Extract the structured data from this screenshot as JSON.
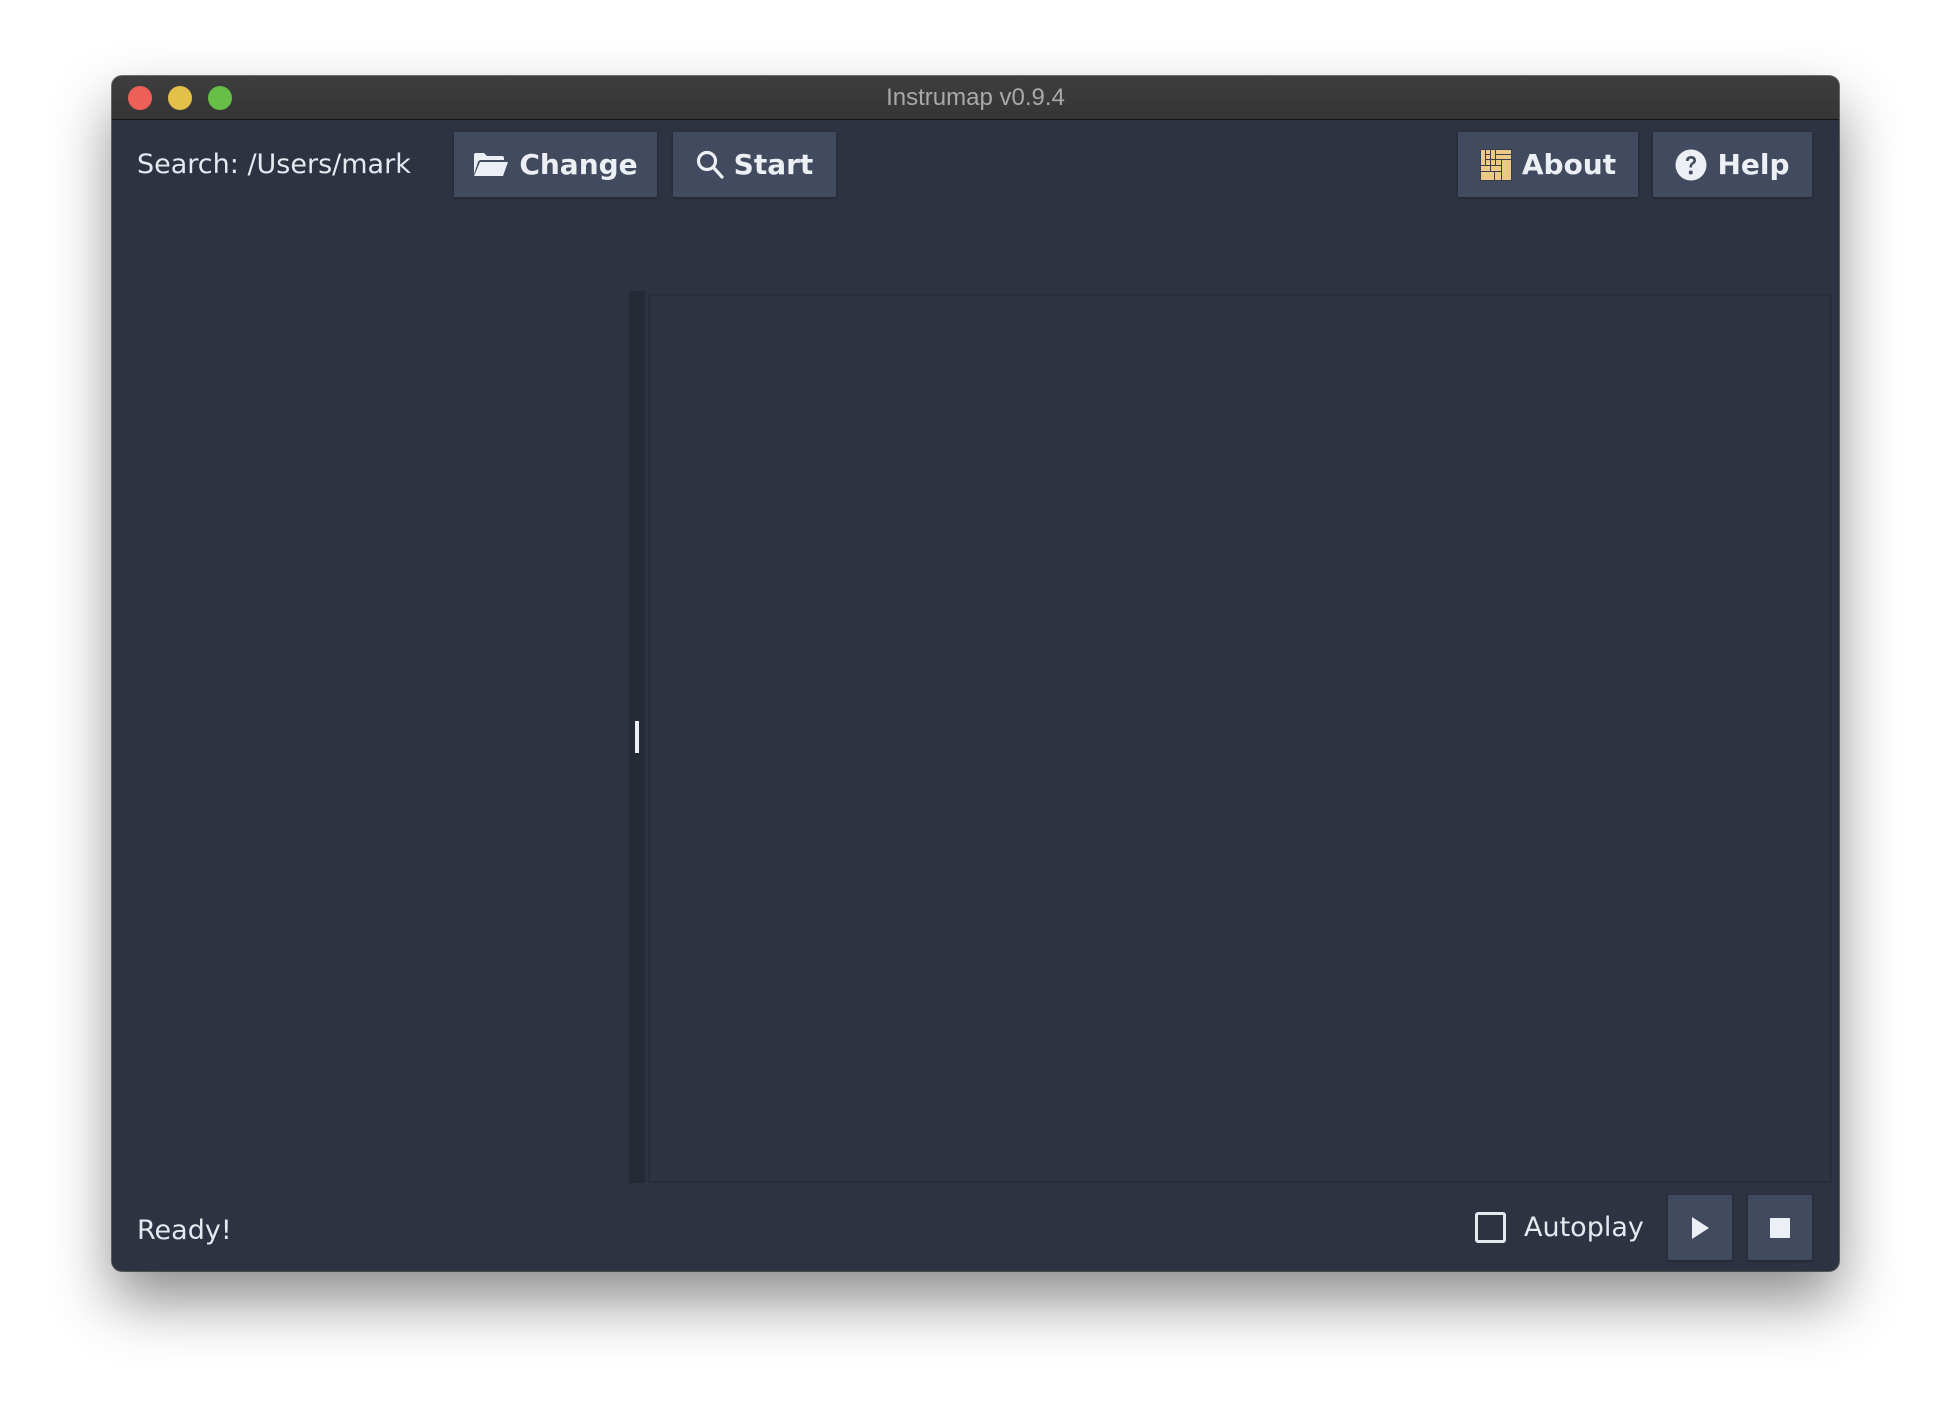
{
  "window": {
    "title": "Instrumap v0.9.4",
    "traffic_lights": {
      "close_color": "#ee5f57",
      "minimize_color": "#e2c04a",
      "maximize_color": "#67be46"
    }
  },
  "toolbar": {
    "search_label": "Search: /Users/mark",
    "change_button": {
      "label": "Change",
      "icon": "folder-open-icon"
    },
    "start_button": {
      "label": "Start",
      "icon": "search-icon"
    },
    "about_button": {
      "label": "About",
      "icon": "treemap-icon",
      "icon_color": "#ecc986"
    },
    "help_button": {
      "label": "Help",
      "icon": "question-circle-icon"
    }
  },
  "panels": {
    "left": {
      "items": []
    },
    "right": {
      "content": []
    }
  },
  "footer": {
    "status": "Ready!",
    "autoplay": {
      "label": "Autoplay",
      "checked": false
    },
    "play_button": {
      "icon": "play-icon"
    },
    "stop_button": {
      "icon": "stop-icon"
    }
  },
  "colors": {
    "background": "#2e3342",
    "button": "#414a5e",
    "text": "#eceff4",
    "splitter": "#252a35"
  }
}
